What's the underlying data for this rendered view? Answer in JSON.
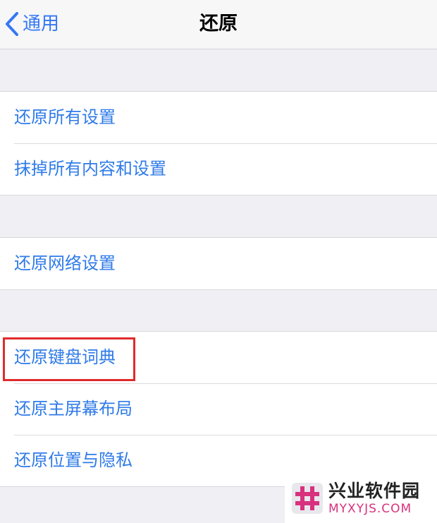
{
  "navbar": {
    "back_label": "通用",
    "title": "还原"
  },
  "groups": [
    {
      "items": [
        {
          "label": "还原所有设置"
        },
        {
          "label": "抹掉所有内容和设置"
        }
      ]
    },
    {
      "items": [
        {
          "label": "还原网络设置"
        }
      ]
    },
    {
      "items": [
        {
          "label": "还原键盘词典"
        },
        {
          "label": "还原主屏幕布局"
        },
        {
          "label": "还原位置与隐私"
        }
      ]
    }
  ],
  "watermark": {
    "name": "兴业软件园",
    "url": "MYXYJS.COM",
    "icon": "hash-logo-icon"
  },
  "colors": {
    "accent": "#3478f6",
    "highlight": "#e02b2b",
    "watermark_pink": "#d8317e"
  }
}
